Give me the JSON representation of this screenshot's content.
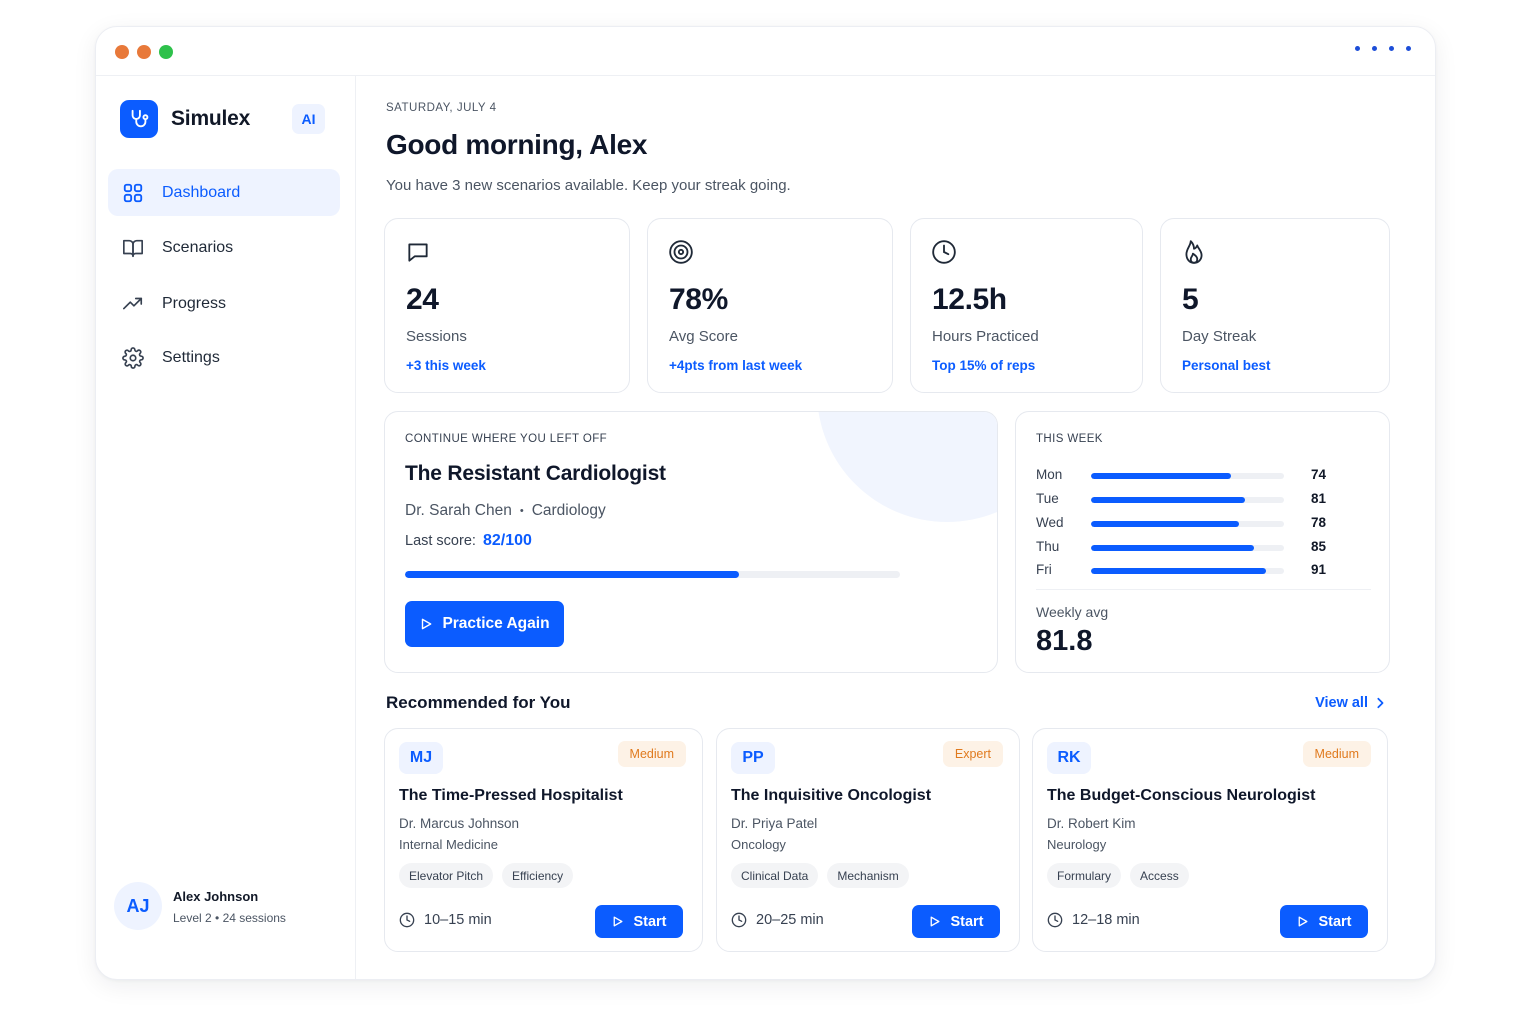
{
  "window": {
    "dot_colors": [
      "#e8793a",
      "#e8793a",
      "#2ec14b"
    ]
  },
  "brand": {
    "name": "Simulex",
    "badge": "AI",
    "accent": "#0b5cff"
  },
  "nav": [
    {
      "label": "Dashboard",
      "icon": "dashboard-grid-icon",
      "active": true
    },
    {
      "label": "Scenarios",
      "icon": "book-open-icon"
    },
    {
      "label": "Progress",
      "icon": "trending-up-icon"
    },
    {
      "label": "Settings",
      "icon": "gear-icon"
    }
  ],
  "user": {
    "initials": "AJ",
    "name": "Alex Johnson",
    "meta": "Level 2 • 24 sessions"
  },
  "header": {
    "date": "SATURDAY, JULY 4",
    "greeting": "Good morning, Alex",
    "subtitle": "You have 3 new scenarios available. Keep your streak going."
  },
  "stats": [
    {
      "icon": "chat-bubble-icon",
      "value": "24",
      "label": "Sessions",
      "note": "+3 this week"
    },
    {
      "icon": "target-icon",
      "value": "78%",
      "label": "Avg Score",
      "note": "+4pts from last week"
    },
    {
      "icon": "clock-icon",
      "value": "12.5h",
      "label": "Hours Practiced",
      "note": "Top 15% of reps"
    },
    {
      "icon": "flame-icon",
      "value": "5",
      "label": "Day Streak",
      "note": "Personal best"
    }
  ],
  "continue": {
    "label": "CONTINUE WHERE YOU LEFT OFF",
    "title": "The Resistant Cardiologist",
    "doctor": "Dr. Sarah Chen",
    "separator": "•",
    "specialty": "Cardiology",
    "last_score_label": "Last score:",
    "last_score": "82/100",
    "progress": 0.675,
    "button": "Practice Again"
  },
  "week": {
    "label": "THIS WEEK",
    "days": [
      {
        "day": "Mon",
        "value": 74,
        "display": "74"
      },
      {
        "day": "Tue",
        "value": 81,
        "display": "81"
      },
      {
        "day": "Wed",
        "value": 78,
        "display": "78"
      },
      {
        "day": "Thu",
        "value": 85,
        "display": "85"
      },
      {
        "day": "Fri",
        "value": 91,
        "display": "91"
      }
    ],
    "max": 100,
    "avg_label": "Weekly avg",
    "avg_value": "81.8"
  },
  "recommended": {
    "title": "Recommended for You",
    "view_all": "View all",
    "cards": [
      {
        "initials": "MJ",
        "level": "Medium",
        "title": "The Time-Pressed Hospitalist",
        "doctor": "Dr. Marcus Johnson",
        "specialty": "Internal Medicine",
        "tags": [
          "Elevator Pitch",
          "Efficiency"
        ],
        "duration": "10–15 min",
        "button": "Start"
      },
      {
        "initials": "PP",
        "level": "Expert",
        "title": "The Inquisitive Oncologist",
        "doctor": "Dr. Priya Patel",
        "specialty": "Oncology",
        "tags": [
          "Clinical Data",
          "Mechanism"
        ],
        "duration": "20–25 min",
        "button": "Start"
      },
      {
        "initials": "RK",
        "level": "Medium",
        "title": "The Budget-Conscious Neurologist",
        "doctor": "Dr. Robert Kim",
        "specialty": "Neurology",
        "tags": [
          "Formulary",
          "Access"
        ],
        "duration": "12–18 min",
        "button": "Start"
      }
    ]
  }
}
